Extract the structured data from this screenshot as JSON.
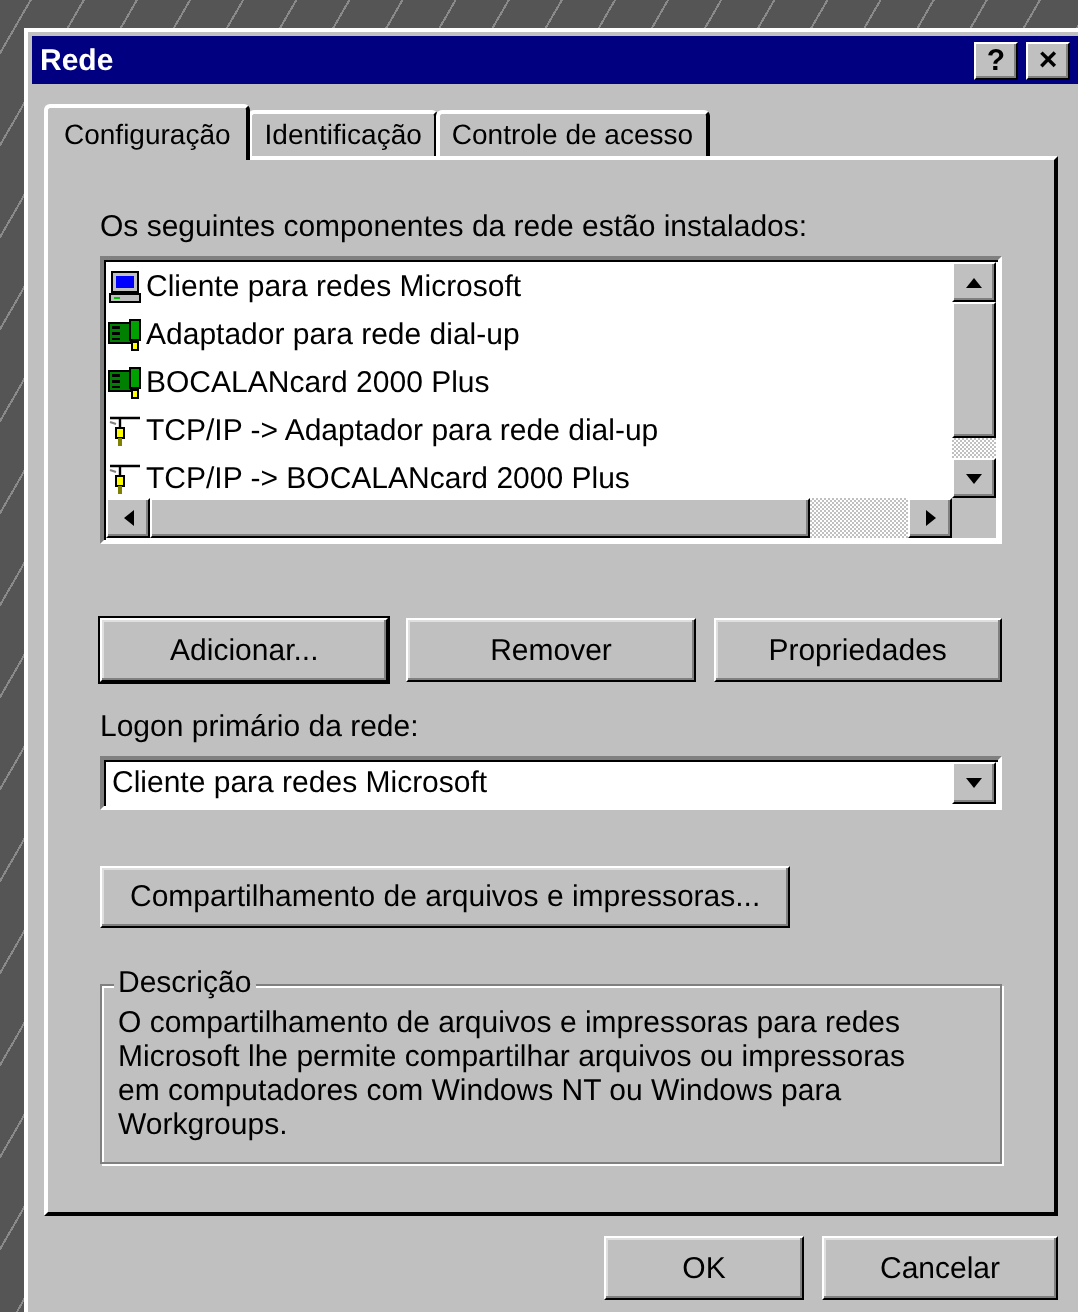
{
  "window": {
    "title": "Rede",
    "title_buttons": [
      {
        "kind": "help",
        "label": "?"
      },
      {
        "kind": "close",
        "label": "×"
      }
    ]
  },
  "tabs": [
    {
      "label": "Configuração",
      "selected": true
    },
    {
      "label": "Identificação",
      "selected": false
    },
    {
      "label": "Controle de acesso",
      "selected": false
    }
  ],
  "components": {
    "label": "Os seguintes componentes da rede estão instalados:",
    "items": [
      {
        "kind": "client",
        "label": "Cliente para redes Microsoft"
      },
      {
        "kind": "adapter",
        "label": "Adaptador para rede dial-up"
      },
      {
        "kind": "adapter",
        "label": "BOCALANcard 2000 Plus"
      },
      {
        "kind": "protocol",
        "label": "TCP/IP -> Adaptador para rede dial-up"
      },
      {
        "kind": "protocol",
        "label": "TCP/IP -> BOCALANcard 2000 Plus"
      }
    ]
  },
  "component_buttons": [
    {
      "label": "Adicionar...",
      "default": true
    },
    {
      "label": "Remover",
      "default": false
    },
    {
      "label": "Propriedades",
      "default": false
    }
  ],
  "logon": {
    "label": "Logon primário da rede:",
    "value": "Cliente para redes Microsoft"
  },
  "sharing_button": {
    "label": "Compartilhamento de arquivos e impressoras..."
  },
  "description": {
    "title": "Descrição",
    "text": "O compartilhamento de arquivos e impressoras para redes Microsoft lhe permite compartilhar arquivos ou impressoras em computadores com Windows NT ou Windows para Workgroups."
  },
  "dialog_buttons": [
    {
      "label": "OK",
      "default": false
    },
    {
      "label": "Cancelar",
      "default": false
    }
  ]
}
